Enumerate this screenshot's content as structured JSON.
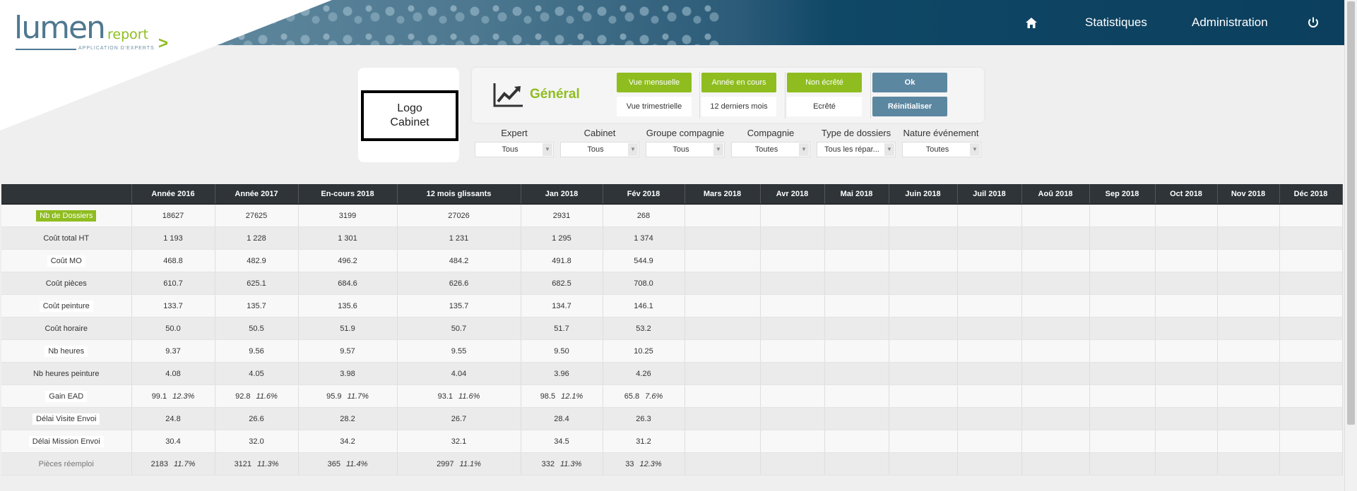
{
  "header": {
    "logo_main": "lumen",
    "logo_report": "report",
    "logo_subtitle": "APPLICATION D'EXPERTS",
    "nav": [
      {
        "icon": "home-icon"
      },
      {
        "label": "Statistiques"
      },
      {
        "label": "Administration"
      },
      {
        "icon": "power-icon"
      }
    ]
  },
  "cabinet_logo": "Logo\nCabinet",
  "panel": {
    "title": "Général",
    "icon": "line-chart-icon",
    "view_monthly": "Vue mensuelle",
    "view_quarterly": "Vue trimestrielle",
    "period_current": "Année en cours",
    "period_12": "12 derniers mois",
    "non_clipped": "Non écrêté",
    "clipped": "Ecrêté",
    "ok": "Ok",
    "reset": "Réinitialiser"
  },
  "filters": [
    {
      "label": "Expert",
      "value": "Tous"
    },
    {
      "label": "Cabinet",
      "value": "Tous"
    },
    {
      "label": "Groupe compagnie",
      "value": "Tous"
    },
    {
      "label": "Compagnie",
      "value": "Toutes"
    },
    {
      "label": "Type de dossiers",
      "value": "Tous les répar..."
    },
    {
      "label": "Nature événement",
      "value": "Toutes"
    }
  ],
  "table": {
    "columns": [
      "",
      "Année 2016",
      "Année 2017",
      "En-cours 2018",
      "12 mois glissants",
      "Jan 2018",
      "Fév 2018",
      "Mars 2018",
      "Avr 2018",
      "Mai 2018",
      "Juin 2018",
      "Juil 2018",
      "Aoû 2018",
      "Sep 2018",
      "Oct 2018",
      "Nov 2018",
      "Déc 2018"
    ],
    "rows": [
      {
        "label": "Nb de Dossiers",
        "values": [
          "18627",
          "27625",
          "3199",
          "27026",
          "2931",
          "268"
        ]
      },
      {
        "label": "Coût total HT",
        "values": [
          "1 193",
          "1 228",
          "1 301",
          "1 231",
          "1 295",
          "1 374"
        ]
      },
      {
        "label": "Coût MO",
        "values": [
          "468.8",
          "482.9",
          "496.2",
          "484.2",
          "491.8",
          "544.9"
        ]
      },
      {
        "label": "Coût pièces",
        "values": [
          "610.7",
          "625.1",
          "684.6",
          "626.6",
          "682.5",
          "708.0"
        ]
      },
      {
        "label": "Coût peinture",
        "values": [
          "133.7",
          "135.7",
          "135.6",
          "135.7",
          "134.7",
          "146.1"
        ]
      },
      {
        "label": "Coût horaire",
        "values": [
          "50.0",
          "50.5",
          "51.9",
          "50.7",
          "51.7",
          "53.2"
        ]
      },
      {
        "label": "Nb heures",
        "values": [
          "9.37",
          "9.56",
          "9.57",
          "9.55",
          "9.50",
          "10.25"
        ]
      },
      {
        "label": "Nb heures peinture",
        "values": [
          "4.08",
          "4.05",
          "3.98",
          "4.04",
          "3.96",
          "4.26"
        ]
      },
      {
        "label": "Gain EAD",
        "values": [
          "99.1",
          "92.8",
          "95.9",
          "93.1",
          "98.5",
          "65.8"
        ],
        "pcts": [
          "12.3%",
          "11.6%",
          "11.7%",
          "11.6%",
          "12.1%",
          "7.6%"
        ]
      },
      {
        "label": "Délai Visite Envoi",
        "values": [
          "24.8",
          "26.6",
          "28.2",
          "26.7",
          "28.4",
          "26.3"
        ]
      },
      {
        "label": "Délai Mission Envoi",
        "values": [
          "30.4",
          "32.0",
          "34.2",
          "32.1",
          "34.5",
          "31.2"
        ]
      },
      {
        "label": "Pièces réemploi",
        "values": [
          "2183",
          "3121",
          "365",
          "2997",
          "332",
          "33"
        ],
        "pcts": [
          "11.7%",
          "11.3%",
          "11.4%",
          "11.1%",
          "11.3%",
          "12.3%"
        ]
      }
    ]
  },
  "colors": {
    "accent": "#8fbd1f",
    "header_dark": "#0c3f5e",
    "button_blue": "#5c87a1",
    "table_head": "#2e3438"
  }
}
